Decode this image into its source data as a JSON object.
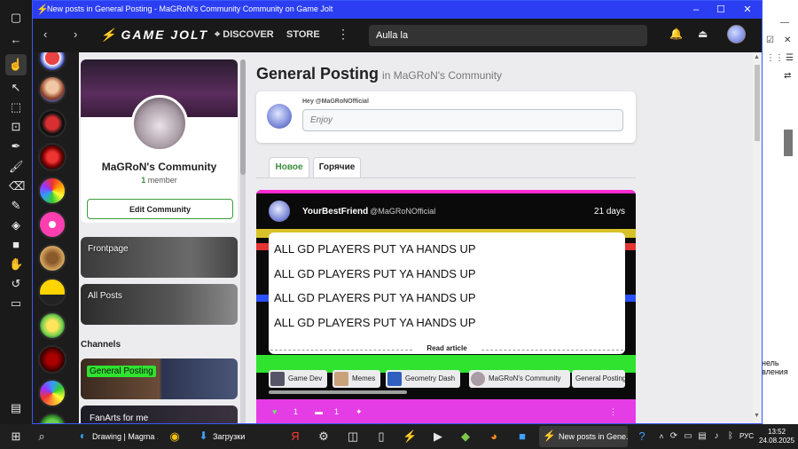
{
  "window": {
    "title": "New posts in General Posting - MaGRoN's Community Community on Game Jolt",
    "minimize": "–",
    "maximize": "☐",
    "close": "✕"
  },
  "topbar": {
    "back": "‹",
    "forward": "›",
    "logo_text": "GAME JOLT",
    "discover": "DISCOVER",
    "store": "STORE",
    "search_value": "Aulla la"
  },
  "community": {
    "name": "MaGRoN's Community",
    "member_count": "1",
    "member_label": "member",
    "edit_label": "Edit Community"
  },
  "nav": {
    "frontpage": "Frontpage",
    "all_posts": "All Posts",
    "channels_heading": "Channels",
    "channels": [
      {
        "label": "General Posting"
      },
      {
        "label": "FanArts for me"
      }
    ]
  },
  "main": {
    "title": "General Posting",
    "subtitle": "in MaGRoN's Community",
    "post_hey": "Hey @MaGRoNOfficial",
    "post_placeholder": "Enjoy",
    "tabs": [
      {
        "label": "Новое",
        "active": true
      },
      {
        "label": "Горячие",
        "active": false
      }
    ]
  },
  "feed": {
    "author": "YourBestFriend",
    "handle": "@MaGRoNOfficial",
    "time": "21 days",
    "lines": [
      "ALL GD PLAYERS PUT YA HANDS UP",
      "ALL GD PLAYERS PUT YA HANDS UP",
      "ALL GD PLAYERS PUT YA HANDS UP",
      "ALL GD PLAYERS PUT YA HANDS UP"
    ],
    "read_article": "Read article",
    "tags": [
      {
        "label": "Game Dev"
      },
      {
        "label": "Memes"
      },
      {
        "label": "Geometry Dash"
      },
      {
        "label": "MaGRoN's Community"
      },
      {
        "label": "General Posting"
      }
    ],
    "likes": "1",
    "comments": "1"
  },
  "background_window": {
    "text_1": "нель",
    "text_2": "вления"
  },
  "taskbar": {
    "apps": [
      {
        "label": "Drawing | Magma ..."
      },
      {
        "label": "Загрузки"
      },
      {
        "label": "New posts in Gene..."
      }
    ],
    "language": "РУС",
    "time": "13:52",
    "date": "24.08.2025"
  },
  "colors": {
    "titlebar": "#2b3ef2",
    "gamejolt_green": "#3c8c3c",
    "channel_active": "#2fe32f"
  }
}
